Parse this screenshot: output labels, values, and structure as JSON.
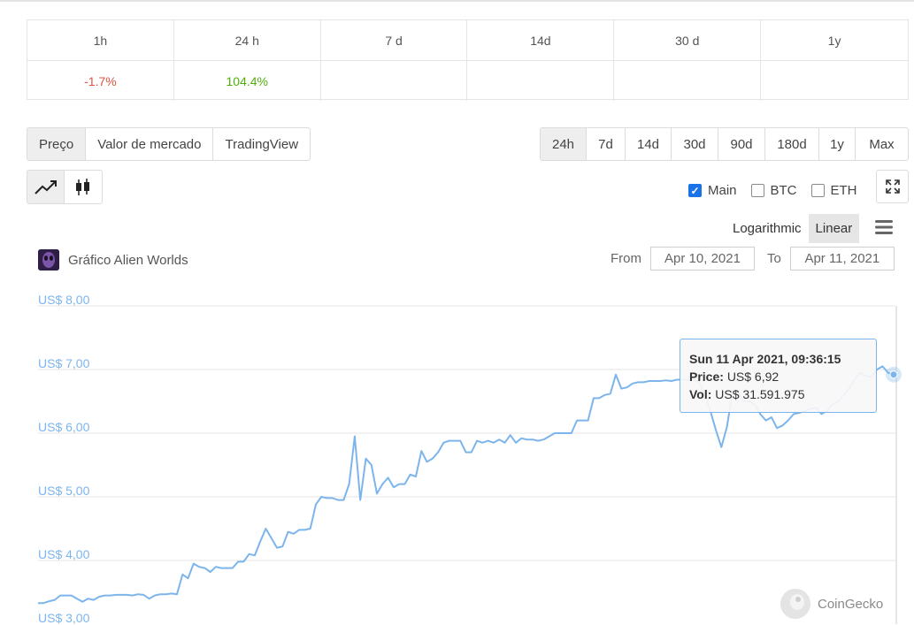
{
  "change_table": {
    "headers": [
      "1h",
      "24 h",
      "7 d",
      "14d",
      "30 d",
      "1y"
    ],
    "values": [
      "-1.7%",
      "104.4%",
      "",
      "",
      "",
      ""
    ]
  },
  "view_tabs": [
    "Preço",
    "Valor de mercado",
    "TradingView"
  ],
  "view_tabs_active": "Preço",
  "range_tabs": [
    "24h",
    "7d",
    "14d",
    "30d",
    "90d",
    "180d",
    "1y",
    "Max"
  ],
  "range_tabs_active": "24h",
  "chart_type_icons": [
    "line-chart-icon",
    "candlestick-icon"
  ],
  "overlays": [
    {
      "label": "Main",
      "checked": true
    },
    {
      "label": "BTC",
      "checked": false
    },
    {
      "label": "ETH",
      "checked": false
    }
  ],
  "scale": {
    "logarithmic": "Logarithmic",
    "linear": "Linear",
    "active": "Linear"
  },
  "chart_title": "Gráfico Alien Worlds",
  "range": {
    "from_label": "From",
    "from_value": "Apr 10, 2021",
    "to_label": "To",
    "to_value": "Apr 11, 2021"
  },
  "tooltip": {
    "date": "Sun 11 Apr 2021, 09:36:15",
    "price_label": "Price:",
    "price_value": "US$ 6,92",
    "vol_label": "Vol:",
    "vol_value": "US$ 31.591.975"
  },
  "brand": "CoinGecko",
  "colors": {
    "line": "#7cb5ec",
    "negative": "#e15241",
    "positive": "#4eaf0a",
    "active_bg": "#eeeeee"
  },
  "chart_data": {
    "type": "line",
    "series": [
      {
        "values": [
          3.33,
          3.33,
          3.36,
          3.38,
          3.45,
          3.45,
          3.45,
          3.4,
          3.35,
          3.4,
          3.38,
          3.43,
          3.45,
          3.45,
          3.46,
          3.46,
          3.46,
          3.45,
          3.47,
          3.46,
          3.4,
          3.45,
          3.47,
          3.47,
          3.48,
          3.47,
          3.78,
          3.72,
          3.95,
          3.9,
          3.88,
          3.82,
          3.9,
          3.88,
          3.88,
          3.88,
          3.98,
          3.98,
          4.1,
          4.08,
          4.3,
          4.5,
          4.35,
          4.2,
          4.22,
          4.45,
          4.42,
          4.48,
          4.48,
          4.5,
          4.88,
          5.0,
          4.98,
          4.98,
          4.95,
          4.95,
          5.2,
          5.95,
          4.95,
          5.6,
          5.5,
          5.05,
          5.2,
          5.3,
          5.15,
          5.2,
          5.2,
          5.35,
          5.32,
          5.72,
          5.55,
          5.6,
          5.7,
          5.85,
          5.88,
          5.88,
          5.88,
          5.7,
          5.7,
          5.88,
          5.85,
          5.88,
          5.85,
          5.9,
          5.85,
          5.97,
          5.85,
          5.92,
          5.9,
          5.9,
          5.88,
          5.9,
          5.95,
          6.0,
          6.0,
          6.0,
          6.0,
          6.2,
          6.2,
          6.2,
          6.55,
          6.55,
          6.6,
          6.62,
          6.92,
          6.7,
          6.72,
          6.78,
          6.8,
          6.8,
          6.82,
          6.82,
          6.82,
          6.83,
          6.82,
          6.84,
          6.84,
          6.84,
          6.84,
          6.8,
          6.6,
          6.35,
          6.05,
          5.78,
          6.1,
          6.65,
          6.65,
          6.5,
          6.5,
          6.45,
          6.3,
          6.2,
          6.25,
          6.08,
          6.12,
          6.2,
          6.3,
          6.32,
          6.35,
          6.38,
          6.4,
          6.3,
          6.35,
          6.45,
          6.5,
          6.6,
          6.7,
          6.85,
          6.95,
          6.9,
          6.88,
          7.0,
          7.05,
          6.95,
          6.92
        ]
      }
    ],
    "x_range_label": "Apr 10, 2021 – Apr 11, 2021",
    "y_ticks": [
      "US$ 8,00",
      "US$ 7,00",
      "US$ 6,00",
      "US$ 5,00",
      "US$ 4,00",
      "US$ 3,00"
    ],
    "ylim": [
      3,
      8
    ],
    "grid": true,
    "scale": "linear"
  }
}
